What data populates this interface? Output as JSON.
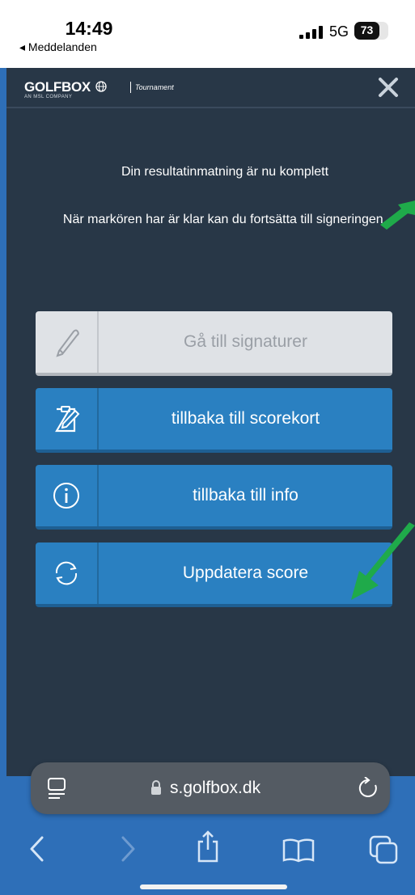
{
  "status_bar": {
    "time": "14:49",
    "back_app": "◂ Meddelanden",
    "network": "5G",
    "battery_level": "73"
  },
  "app": {
    "logo_text": "GOLFBOX",
    "logo_subtext": "AN MSL COMPANY",
    "logo_tagline": "Tournament",
    "message_line1": "Din resultatinmatning är nu komplett",
    "message_line2": "När markören har är klar kan du fortsätta till signeringen.",
    "buttons": [
      {
        "label": "Gå till signaturer",
        "icon": "pen-icon",
        "enabled": false
      },
      {
        "label": "tillbaka till scorekort",
        "icon": "scorecard-edit-icon",
        "enabled": true
      },
      {
        "label": "tillbaka till info",
        "icon": "info-icon",
        "enabled": true
      },
      {
        "label": "Uppdatera score",
        "icon": "refresh-icon",
        "enabled": true
      }
    ]
  },
  "browser": {
    "url": "s.golfbox.dk"
  },
  "colors": {
    "page_bg": "#2e6fb8",
    "app_bg": "#283747",
    "button_primary": "#2a80c1",
    "button_disabled": "#dfe2e6",
    "annotation_arrow": "#1faa4a"
  }
}
